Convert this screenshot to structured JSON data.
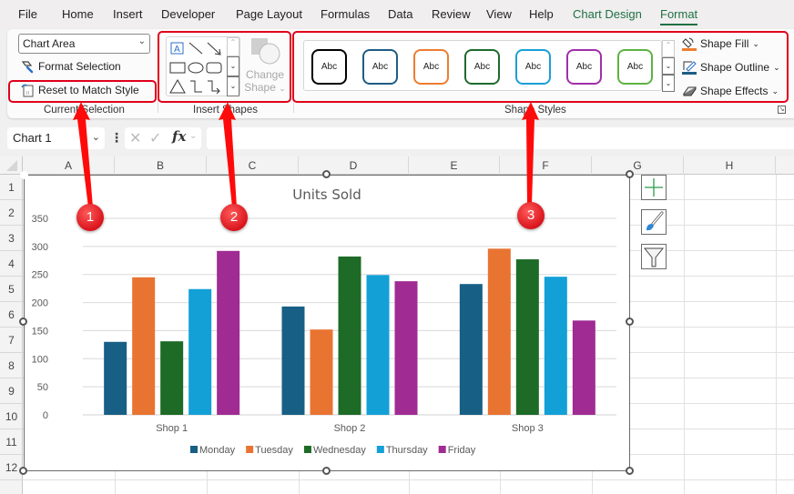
{
  "menu": {
    "tabs": [
      {
        "label": "File"
      },
      {
        "label": "Home"
      },
      {
        "label": "Insert"
      },
      {
        "label": "Developer"
      },
      {
        "label": "Page Layout"
      },
      {
        "label": "Formulas"
      },
      {
        "label": "Data"
      },
      {
        "label": "Review"
      },
      {
        "label": "View"
      },
      {
        "label": "Help"
      },
      {
        "label": "Chart Design"
      },
      {
        "label": "Format"
      }
    ],
    "active_tab": "Format"
  },
  "ribbon": {
    "current_selection": {
      "group_label": "Current Selection",
      "element_select": "Chart Area",
      "format_selection": "Format Selection",
      "reset_to_match_style": "Reset to Match Style"
    },
    "insert_shapes": {
      "group_label": "Insert Shapes",
      "change_shape_line1": "Change",
      "change_shape_line2": "Shape"
    },
    "shape_styles": {
      "group_label": "Shape Styles",
      "presets": [
        {
          "label": "Abc",
          "color": "#000000"
        },
        {
          "label": "Abc",
          "color": "#1f5d84"
        },
        {
          "label": "Abc",
          "color": "#ed7d31"
        },
        {
          "label": "Abc",
          "color": "#1e6b2e"
        },
        {
          "label": "Abc",
          "color": "#1a9fd8"
        },
        {
          "label": "Abc",
          "color": "#a02fa8"
        },
        {
          "label": "Abc",
          "color": "#5db342"
        }
      ],
      "shape_fill": "Shape Fill",
      "shape_outline": "Shape Outline",
      "shape_effects": "Shape Effects"
    }
  },
  "formula_bar": {
    "name_box": "Chart 1",
    "fx": "fx",
    "formula": ""
  },
  "grid": {
    "columns": [
      "A",
      "B",
      "C",
      "D",
      "E",
      "F",
      "G",
      "H"
    ],
    "rows": [
      "1",
      "2",
      "3",
      "4",
      "5",
      "6",
      "7",
      "8",
      "9",
      "10",
      "11",
      "12"
    ]
  },
  "chart_data": {
    "type": "bar",
    "title": "Units Sold",
    "categories": [
      "Shop 1",
      "Shop 2",
      "Shop 3"
    ],
    "series": [
      {
        "name": "Monday",
        "color": "#175f85",
        "values": [
          130,
          193,
          233
        ]
      },
      {
        "name": "Tuesday",
        "color": "#e97432",
        "values": [
          245,
          152,
          296
        ]
      },
      {
        "name": "Wednesday",
        "color": "#1d6b26",
        "values": [
          131,
          282,
          277
        ]
      },
      {
        "name": "Thursday",
        "color": "#12a0d7",
        "values": [
          224,
          249,
          246
        ]
      },
      {
        "name": "Friday",
        "color": "#a02b93",
        "values": [
          292,
          238,
          168
        ]
      }
    ],
    "ylim": [
      0,
      350
    ],
    "yticks": [
      0,
      50,
      100,
      150,
      200,
      250,
      300,
      350
    ],
    "xlabel": "",
    "ylabel": "",
    "grid": true,
    "legend": "bottom"
  },
  "annotations": [
    {
      "number": "1",
      "target": "Reset to Match Style"
    },
    {
      "number": "2",
      "target": "Insert Shapes"
    },
    {
      "number": "3",
      "target": "Shape Styles"
    }
  ],
  "colors": {
    "accent_green": "#1e7145",
    "annotation_red": "#e0001b"
  }
}
